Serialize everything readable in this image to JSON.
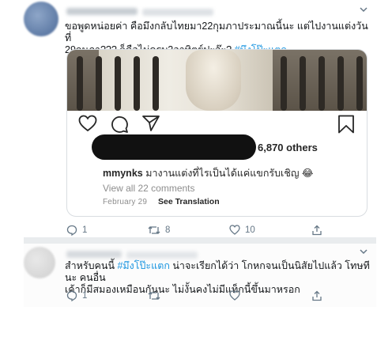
{
  "tweet1": {
    "text_line1": "ขอพูดหน่อยค่า คือมึงกลับไทยมา22กุมภาประมาณนี้นะ แต่ไปงานแต่งวันที่",
    "text_line2": "29กุมภา??? ก็คือไม่ครบ2อาทิตย์ปะจ๊ะ?",
    "hashtag": "#มึงโป๊ะแตก",
    "embed": {
      "likes": "6,870 others",
      "caption_user": "mmynks",
      "caption_text": "มางานแต่งที่ไรเป็นได้แค่แขกรับเชิญ 😂",
      "view_comments": "View all 22 comments",
      "date": "February 29",
      "see_translation": "See Translation"
    },
    "actions": {
      "reply_count": "1",
      "retweet_count": "8",
      "like_count": "10"
    }
  },
  "tweet2": {
    "prefix": "สำหรับคนนี้",
    "hashtag": "#มึงโป๊ะแตก",
    "suffix": "น่าจะเรียกได้ว่า โกหกจนเป็นนิสัยไปแล้ว โทษทีนะ คนอื่น",
    "line2": "เค้าก็มีสมองเหมือนกันนะ ไม่งั้นคงไม่มีแท็กนี้ขึ้นมาหรอก",
    "actions": {
      "reply_count": "1"
    }
  },
  "colors": {
    "link": "#1b95e0",
    "muted": "#657786",
    "text": "#14171a"
  },
  "icons": [
    "chevron-down-icon",
    "heart-icon",
    "comment-icon",
    "share-icon",
    "bookmark-icon",
    "reply-icon",
    "retweet-icon",
    "like-icon",
    "tweet-share-icon"
  ]
}
